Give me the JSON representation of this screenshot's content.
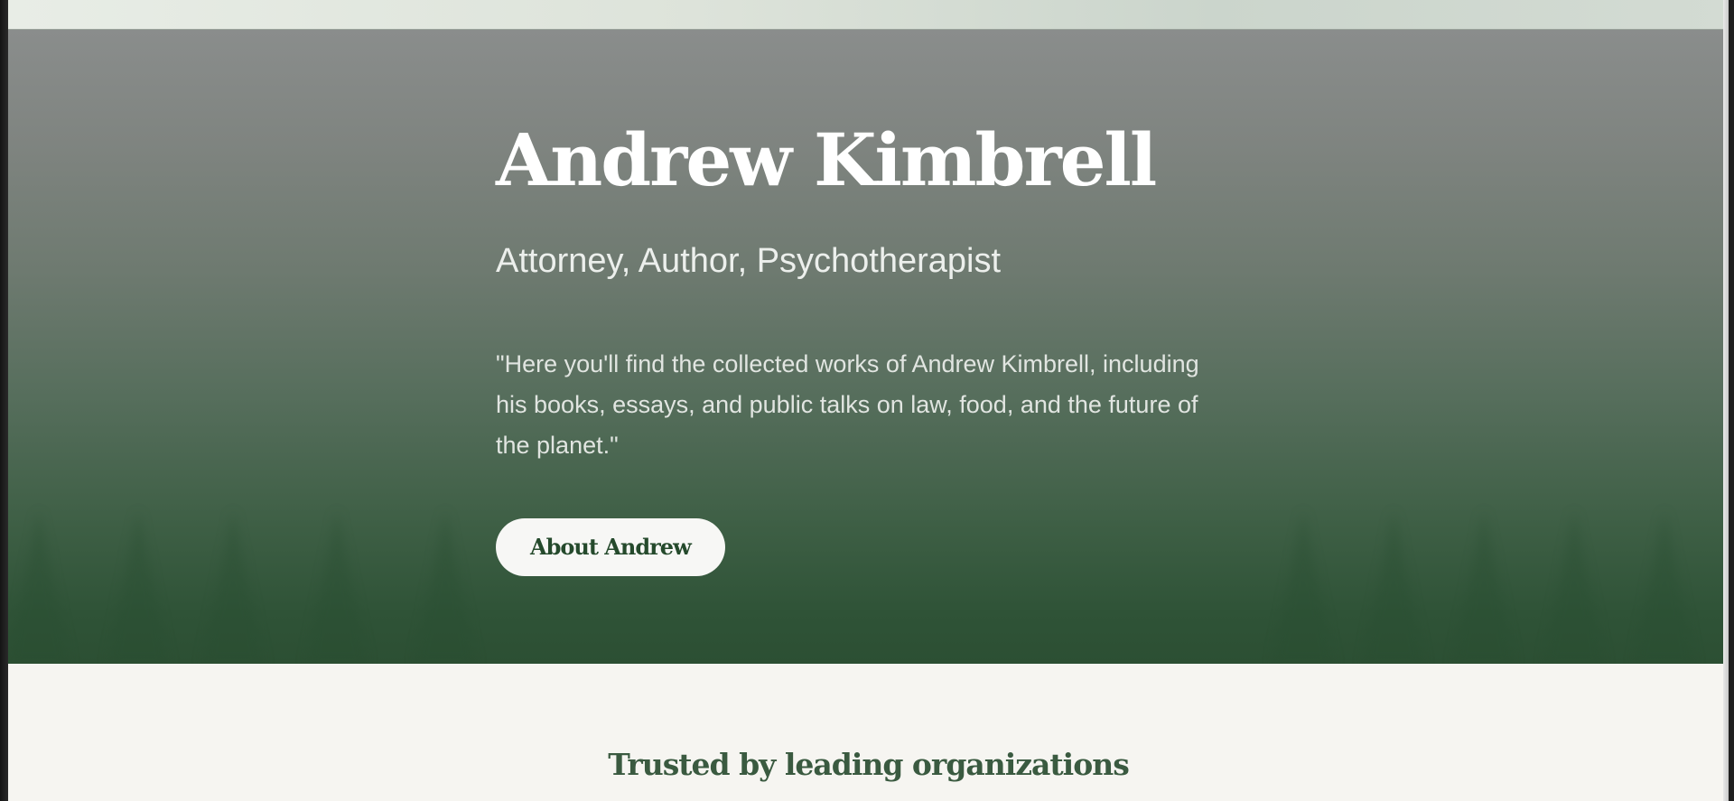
{
  "hero": {
    "title": "Andrew Kimbrell",
    "subtitle": "Attorney, Author, Psychotherapist",
    "quote": "\"Here you'll find the collected works of Andrew Kimbrell, including his books, essays, and public talks on law, food, and the future of the planet.\"",
    "button_label": "About Andrew"
  },
  "trusted": {
    "heading": "Trusted by leading organizations"
  },
  "colors": {
    "hero_top": "#8a8d8c",
    "hero_bottom": "#2c4f33",
    "page_background": "#f6f5f1",
    "accent_green": "#254a2c",
    "button_background": "#f7f7f5"
  },
  "icons": []
}
